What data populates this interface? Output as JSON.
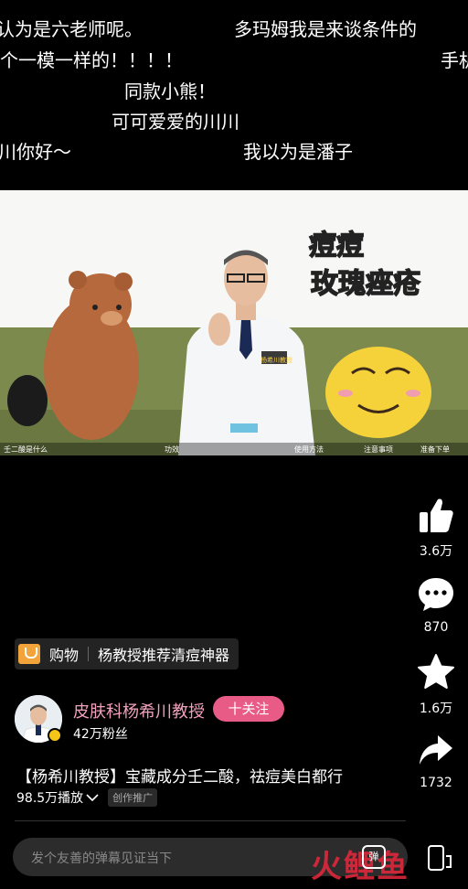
{
  "danmaku": [
    {
      "text": "认为是六老师呢。"
    },
    {
      "text": "多玛姆我是来谈条件的"
    },
    {
      "text": "个一模一样的！！！！"
    },
    {
      "text": "手机"
    },
    {
      "text": "同款小熊！"
    },
    {
      "text": "可可爱爱的川川"
    },
    {
      "text": "川你好～"
    },
    {
      "text": "我以为是潘子"
    }
  ],
  "video": {
    "overlay_line1": "痘痘",
    "overlay_line2": "玫瑰痤疮",
    "badge": "杨希川教授",
    "chapters": [
      "壬二酸是什么",
      "功效",
      "使用方法",
      "注意事项",
      "准备下单"
    ]
  },
  "actions": {
    "like_count": "3.6万",
    "comment_count": "870",
    "favorite_count": "1.6万",
    "share_count": "1732"
  },
  "shop": {
    "label": "购物",
    "product": "杨教授推荐清痘神器"
  },
  "author": {
    "name": "皮肤科杨希川教授",
    "fans": "42万粉丝",
    "follow_label": "十关注"
  },
  "post": {
    "title": "【杨希川教授】宝藏成分壬二酸，祛痘美白都行",
    "plays": "98.5万播放",
    "tag": "创作推广"
  },
  "comment_box": {
    "placeholder": "发个友善的弹幕见证当下",
    "danmaku_toggle": "弹"
  },
  "watermark": "火鲤鱼",
  "colors": {
    "author_name": "#f2a1bd",
    "follow_button": "#e85b86",
    "shop_icon": "#f2a43a"
  }
}
